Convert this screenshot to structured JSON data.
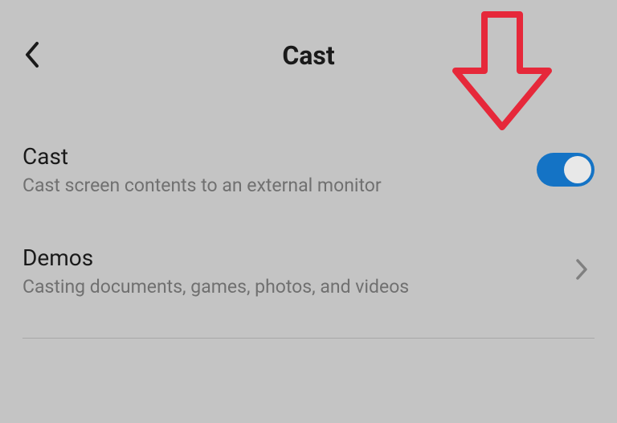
{
  "header": {
    "title": "Cast"
  },
  "settings": {
    "cast": {
      "title": "Cast",
      "description": "Cast screen contents to an external monitor",
      "enabled": true
    },
    "demos": {
      "title": "Demos",
      "description": "Casting documents, games, photos, and videos"
    }
  },
  "colors": {
    "toggleOn": "#1473c5",
    "annotationArrow": "#e6283a"
  }
}
